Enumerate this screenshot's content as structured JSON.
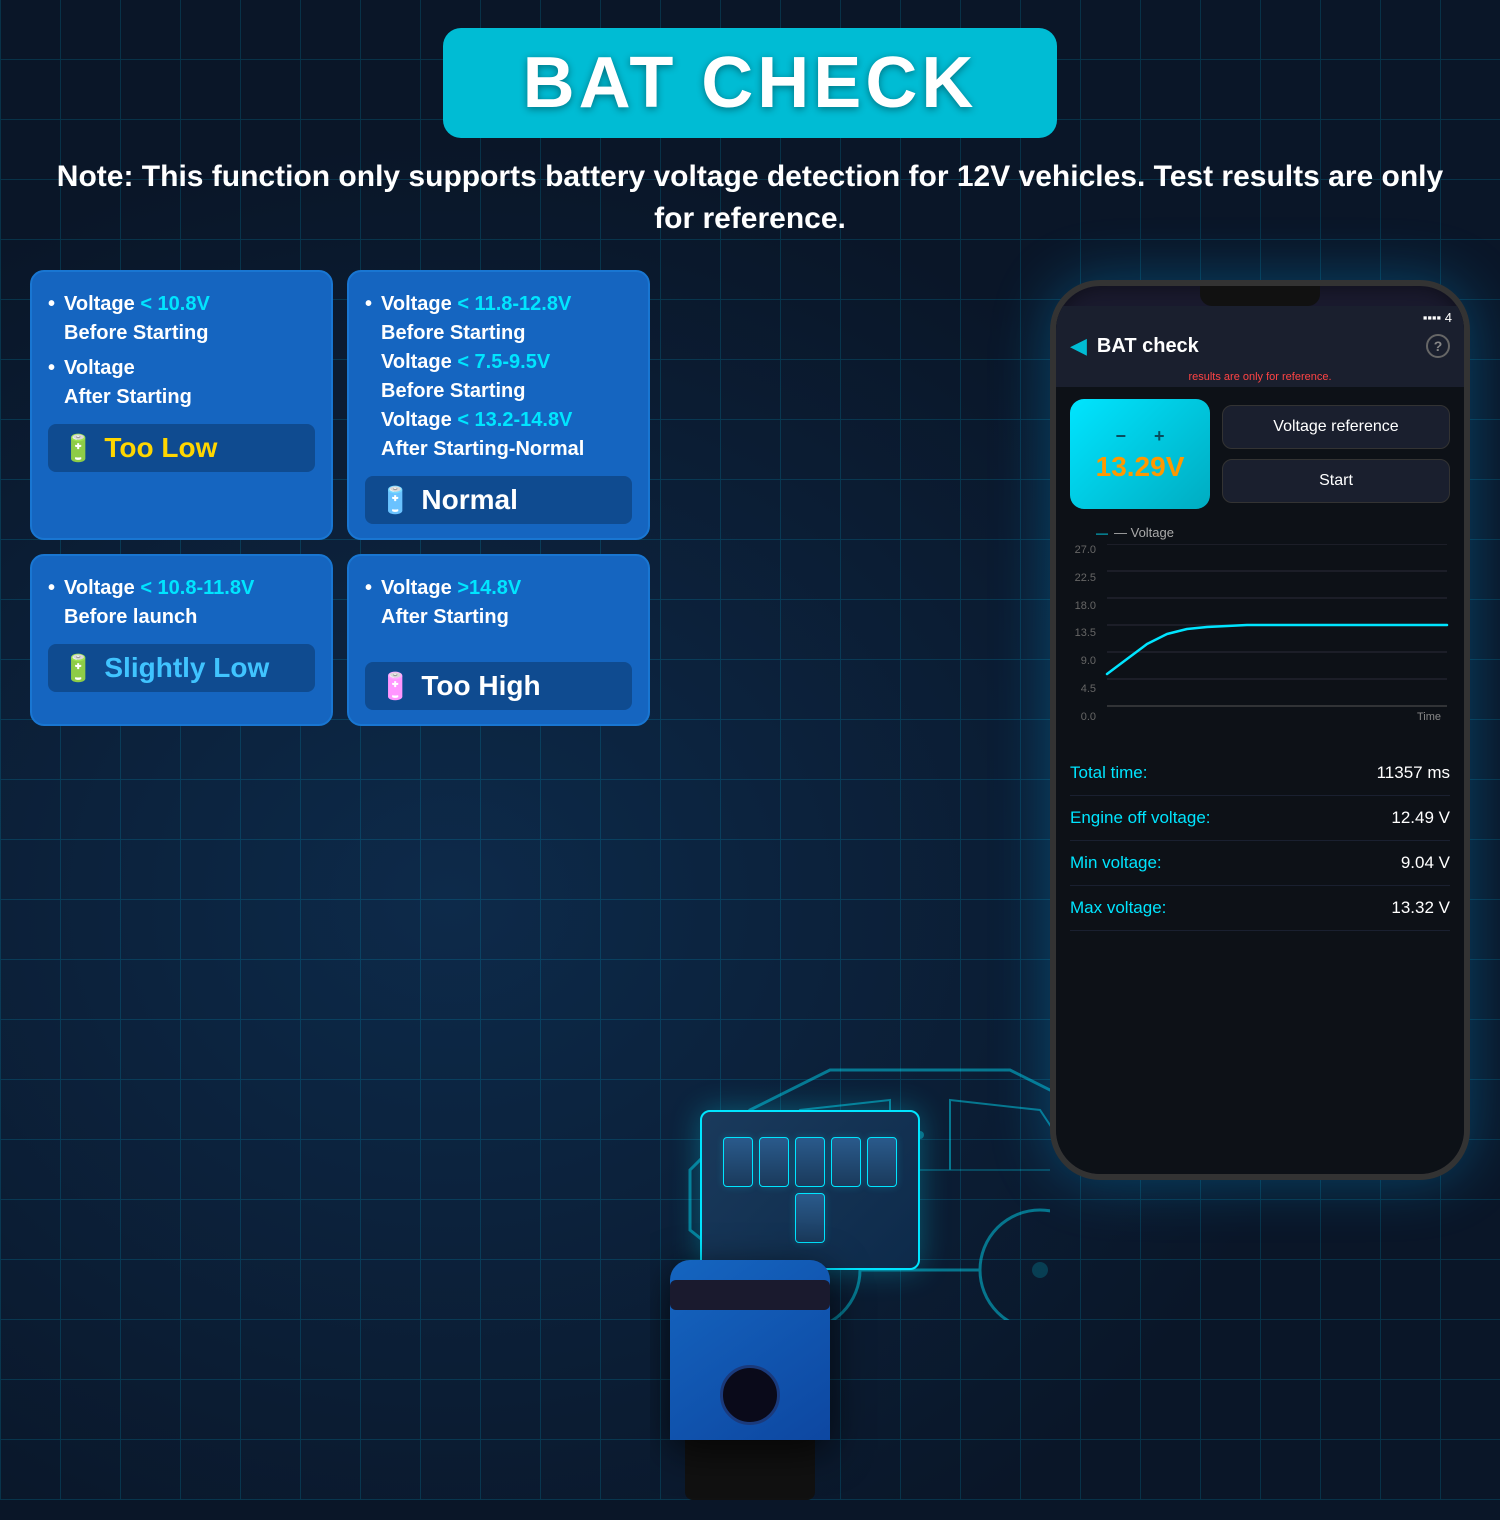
{
  "header": {
    "title": "BAT CHECK",
    "note": "Note:  This function only supports battery voltage detection for 12V vehicles. Test results are only for reference."
  },
  "cards": [
    {
      "id": "too-low",
      "bullets": [
        {
          "text": "Voltage ",
          "highlight": "< 10.8V",
          "rest": "\nBefore Starting"
        },
        {
          "text": "Voltage\nAfter Starting",
          "highlight": ""
        }
      ],
      "status": "Too Low",
      "statusClass": "too-low",
      "icon": "🔋"
    },
    {
      "id": "normal",
      "bullets": [
        {
          "text": "Voltage ",
          "highlight": "< 11.8-12.8V",
          "rest": "\nBefore Starting\nVoltage ",
          "highlight2": "< 7.5-9.5V",
          "rest2": "\nBefore Starting\nVoltage ",
          "highlight3": "< 13.2-14.8V",
          "rest3": "\nAfter Starting-Normal"
        }
      ],
      "status": "Normal",
      "statusClass": "normal",
      "icon": "🔋"
    },
    {
      "id": "slightly-low",
      "bullets": [
        {
          "text": "Voltage ",
          "highlight": "< 10.8-11.8V",
          "rest": "\nBefore launch"
        }
      ],
      "status": "Slightly Low",
      "statusClass": "slightly-low",
      "icon": "🔋"
    },
    {
      "id": "too-high",
      "bullets": [
        {
          "text": "Voltage ",
          "highlight": ">14.8V",
          "rest": "\nAfter Starting"
        }
      ],
      "status": "Too High",
      "statusClass": "too-high",
      "icon": "🔋"
    }
  ],
  "phone": {
    "title": "BAT check",
    "ref_note": "results are only for reference.",
    "voltage": "13.29V",
    "btn_voltage_ref": "Voltage reference",
    "btn_start": "Start",
    "chart": {
      "label": "— Voltage",
      "y_labels": [
        "27.0",
        "22.5",
        "18.0",
        "13.5",
        "9.0",
        "4.5",
        "0.0"
      ],
      "x_label": "Time",
      "line_color": "#00e5ff"
    },
    "stats": [
      {
        "label": "Total time:",
        "value": "11357 ms"
      },
      {
        "label": "Engine off voltage:",
        "value": "12.49 V"
      },
      {
        "label": "Min voltage:",
        "value": "9.04 V"
      },
      {
        "label": "Max voltage:",
        "value": "13.32 V"
      }
    ]
  },
  "colors": {
    "accent_cyan": "#00e5ff",
    "accent_blue": "#1565c0",
    "too_low_color": "#ffd600",
    "normal_color": "#4caf50",
    "slightly_low_color": "#40c4ff",
    "too_high_color": "#f44336",
    "bg_dark": "#0a1628",
    "card_bg": "#1565c0"
  }
}
